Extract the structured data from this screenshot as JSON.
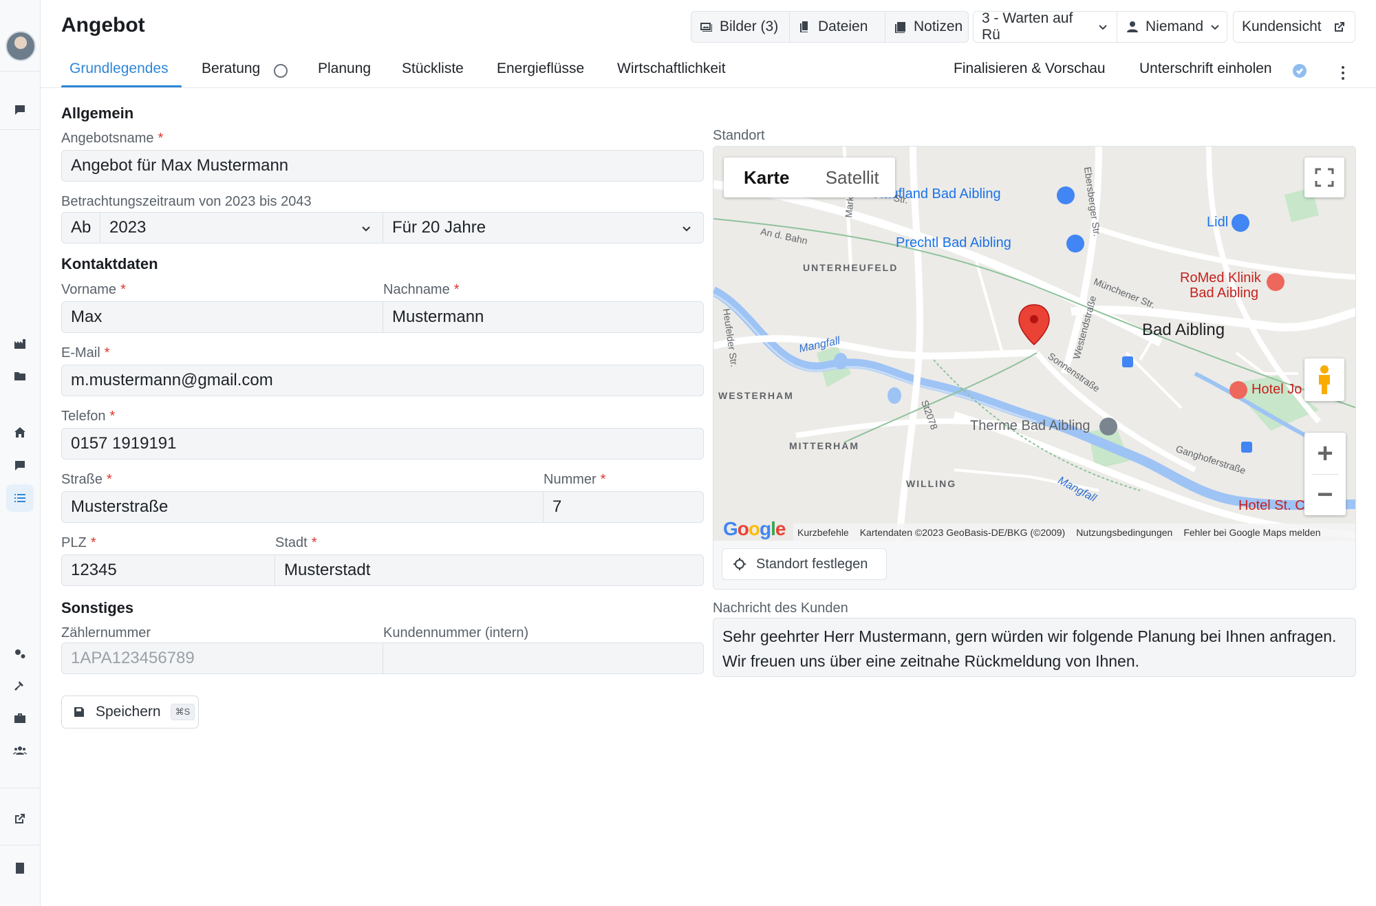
{
  "header": {
    "title": "Angebot",
    "bilder": "Bilder (3)",
    "dateien": "Dateien",
    "notizen": "Notizen",
    "status": "3 - Warten auf Rü",
    "assignee": "Niemand",
    "kundensicht": "Kundensicht"
  },
  "tabs": [
    {
      "label": "Grundlegendes"
    },
    {
      "label": "Beratung"
    },
    {
      "label": "Planung"
    },
    {
      "label": "Stückliste"
    },
    {
      "label": "Energieflüsse"
    },
    {
      "label": "Wirtschaftlichkeit"
    }
  ],
  "tabs_right": {
    "finalize": "Finalisieren & Vorschau",
    "signature": "Unterschrift einholen"
  },
  "form": {
    "allgemein": "Allgemein",
    "angebotsname_label": "Angebotsname",
    "angebotsname": "Angebot für Max Mustermann",
    "zeitraum_label": "Betrachtungszeitraum von 2023 bis 2043",
    "ab": "Ab",
    "year": "2023",
    "duration": "Für 20 Jahre",
    "kontakt": "Kontaktdaten",
    "vorname_label": "Vorname",
    "vorname": "Max",
    "nachname_label": "Nachname",
    "nachname": "Mustermann",
    "email_label": "E-Mail",
    "email": "m.mustermann@gmail.com",
    "telefon_label": "Telefon",
    "telefon": "0157 1919191",
    "strasse_label": "Straße",
    "strasse": "Musterstraße",
    "nummer_label": "Nummer",
    "nummer": "7",
    "plz_label": "PLZ",
    "plz": "12345",
    "stadt_label": "Stadt",
    "stadt": "Musterstadt",
    "sonstiges": "Sonstiges",
    "zaehler_label": "Zählernummer",
    "zaehler_placeholder": "1APA123456789",
    "kunden_label": "Kundennummer (intern)",
    "required_mark": "*",
    "save": "Speichern",
    "save_shortcut": "⌘S"
  },
  "map": {
    "label": "Standort",
    "type_map": "Karte",
    "type_satellite": "Satellit",
    "labels": {
      "kaufland": "Kaufland Bad Aibling",
      "prechtl": "Prechtl Bad Aibling",
      "lidl": "Lidl",
      "romed1": "RoMed Klinik",
      "romed2": "Bad Aibling",
      "bad_aibling": "Bad Aibling",
      "hotel_jo": "Hotel Jo",
      "therme": "Therme Bad Aibling",
      "hotel_st": "Hotel St. C",
      "unterheufeld": "UNTERHEUFELD",
      "westerham": "WESTERHAM",
      "mitterham": "MITTERHAM",
      "willing": "WILLING",
      "an_d_bahn": "An d. Bahn",
      "muenchener": "Münchener Str.",
      "westendstr": "Westendstraße",
      "sonnenstr": "Sonnenstraße",
      "ganghofer": "Ganghoferstraße",
      "ebersberger": "Ebersberger Str.",
      "heufelder": "Heufelder Str.",
      "st2078": "St2078",
      "mangfall": "Mangfall",
      "markt": "Markt",
      "str": "Str."
    },
    "google": "Google",
    "attribution": [
      "Kurzbefehle",
      "Kartendaten ©2023 GeoBasis-DE/BKG (©2009)",
      "Nutzungsbedingungen",
      "Fehler bei Google Maps melden"
    ],
    "set_location": "Standort festlegen"
  },
  "message": {
    "label": "Nachricht des Kunden",
    "text": "Sehr geehrter Herr Mustermann, gern würden wir folgende Planung bei Ihnen anfragen. Wir freuen uns über eine zeitnahe Rückmeldung von Ihnen."
  }
}
